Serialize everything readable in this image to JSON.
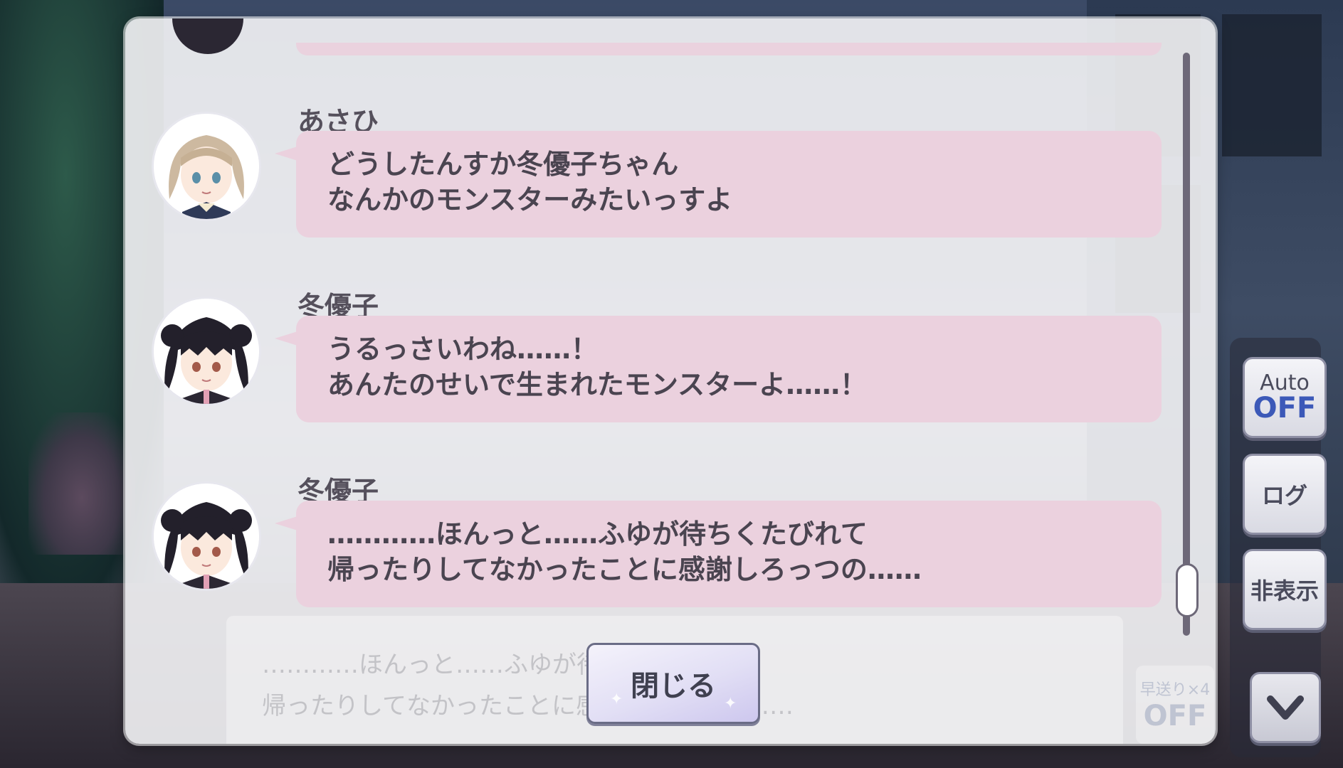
{
  "controls": {
    "auto_label": "Auto",
    "auto_state": "OFF",
    "log_label": "ログ",
    "hide_label": "非表示"
  },
  "log": {
    "entries": [
      {
        "name": "あさひ",
        "lines": [
          "どうしたんすか冬優子ちゃん",
          "なんかのモンスターみたいっすよ"
        ]
      },
      {
        "name": "冬優子",
        "lines": [
          "うるっさいわね……！",
          "あんたのせいで生まれたモンスターよ……！"
        ]
      },
      {
        "name": "冬優子",
        "lines": [
          "…………ほんっと……ふゆが待ちくたびれて",
          "帰ったりしてなかったことに感謝しろっつの……"
        ]
      }
    ],
    "close_label": "閉じる"
  },
  "background_dialog": {
    "line1": "…………ほんっと……ふゆが待ちくたびれて",
    "line2": "帰ったりしてなかったことに感謝しろっつの……",
    "fast_forward_label": "早送り×4",
    "fast_forward_state": "OFF"
  },
  "colors": {
    "bubble": "#ebd1de",
    "panel": "#f4f4f6",
    "auto_off": "#3c59b8"
  }
}
